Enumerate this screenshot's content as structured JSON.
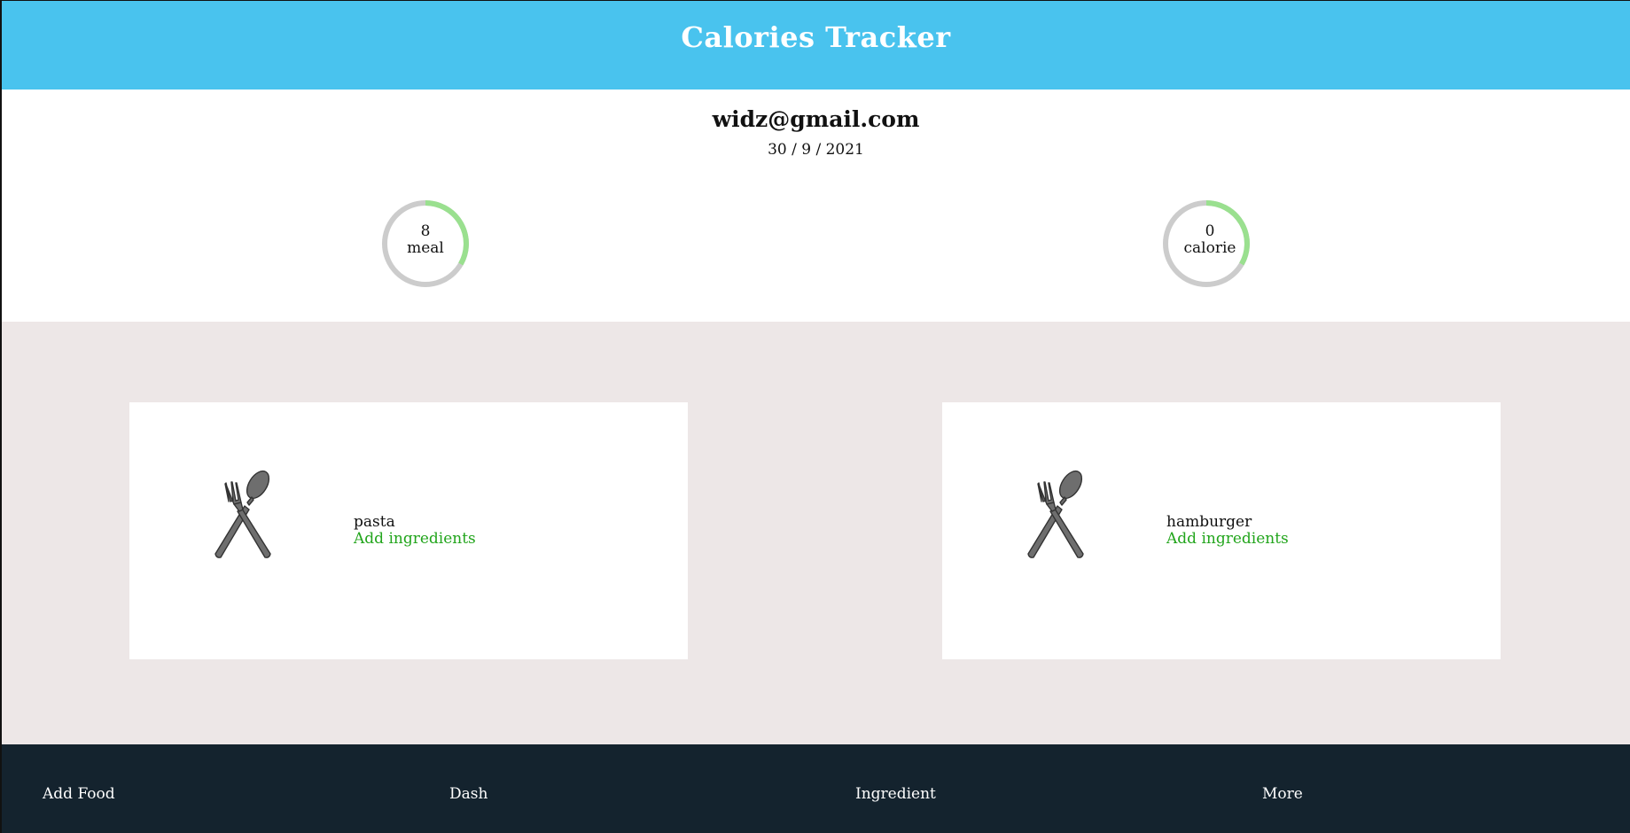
{
  "header": {
    "title": "Calories Tracker"
  },
  "user": {
    "email": "widz@gmail.com",
    "date": "30 / 9 / 2021"
  },
  "stats": {
    "meal": {
      "value": "8",
      "label": "meal"
    },
    "calorie": {
      "value": "0",
      "label": "calorie"
    },
    "ring_track_color": "#cccccc",
    "ring_progress_color": "#9ae08f"
  },
  "foods": [
    {
      "name": "pasta",
      "action": "Add ingredients",
      "icon": "fork-spoon-icon"
    },
    {
      "name": "hamburger",
      "action": "Add ingredients",
      "icon": "fork-spoon-icon"
    }
  ],
  "nav": {
    "add_food": "Add Food",
    "dash": "Dash",
    "ingredient": "Ingredient",
    "more": "More"
  },
  "colors": {
    "header_bg": "#49c3ee",
    "cards_bg": "#ede7e7",
    "nav_bg": "#14232e",
    "link": "#22a51c"
  }
}
